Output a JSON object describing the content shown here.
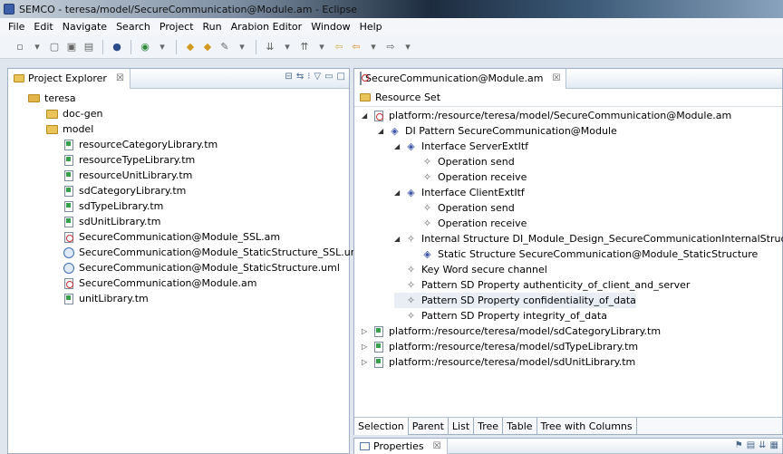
{
  "window": {
    "title": "SEMCO - teresa/model/SecureCommunication@Module.am - Eclipse"
  },
  "menu": [
    "File",
    "Edit",
    "Navigate",
    "Search",
    "Project",
    "Run",
    "Arabion Editor",
    "Window",
    "Help"
  ],
  "project_explorer": {
    "tab_label": "Project Explorer",
    "close": "☒",
    "root": "teresa",
    "folders": [
      "doc-gen",
      "model"
    ],
    "files": [
      {
        "name": "resourceCategoryLibrary.tm",
        "kind": "tm"
      },
      {
        "name": "resourceTypeLibrary.tm",
        "kind": "tm"
      },
      {
        "name": "resourceUnitLibrary.tm",
        "kind": "tm"
      },
      {
        "name": "sdCategoryLibrary.tm",
        "kind": "tm"
      },
      {
        "name": "sdTypeLibrary.tm",
        "kind": "tm"
      },
      {
        "name": "sdUnitLibrary.tm",
        "kind": "tm"
      },
      {
        "name": "SecureCommunication@Module_SSL.am",
        "kind": "am"
      },
      {
        "name": "SecureCommunication@Module_StaticStructure_SSL.uml",
        "kind": "uml"
      },
      {
        "name": "SecureCommunication@Module_StaticStructure.uml",
        "kind": "uml"
      },
      {
        "name": "SecureCommunication@Module.am",
        "kind": "am"
      },
      {
        "name": "unitLibrary.tm",
        "kind": "tm"
      }
    ]
  },
  "editor": {
    "tab_label": "SecureCommunication@Module.am",
    "close": "☒",
    "resource_set_label": "Resource Set",
    "tree": [
      {
        "label": "platform:/resource/teresa/model/SecureCommunication@Module.am",
        "level": 0,
        "arrow": "◢",
        "icon": "am"
      },
      {
        "label": "DI Pattern SecureCommunication@Module",
        "level": 1,
        "arrow": "◢",
        "icon": "diamond"
      },
      {
        "label": "Interface ServerExtItf",
        "level": 2,
        "arrow": "◢",
        "icon": "diamond"
      },
      {
        "label": "Operation send",
        "level": 3,
        "arrow": "",
        "icon": "diamond-g"
      },
      {
        "label": "Operation receive",
        "level": 3,
        "arrow": "",
        "icon": "diamond-g"
      },
      {
        "label": "Interface ClientExtItf",
        "level": 2,
        "arrow": "◢",
        "icon": "diamond"
      },
      {
        "label": "Operation send",
        "level": 3,
        "arrow": "",
        "icon": "diamond-g"
      },
      {
        "label": "Operation receive",
        "level": 3,
        "arrow": "",
        "icon": "diamond-g"
      },
      {
        "label": "Internal Structure DI_Module_Design_SecureCommunicationInternalStructure",
        "level": 2,
        "arrow": "◢",
        "icon": "diamond-g"
      },
      {
        "label": "Static Structure SecureCommunication@Module_StaticStructure",
        "level": 3,
        "arrow": "",
        "icon": "diamond"
      },
      {
        "label": "Key Word secure channel",
        "level": 2,
        "arrow": "",
        "icon": "diamond-g"
      },
      {
        "label": "Pattern SD Property authenticity_of_client_and_server",
        "level": 2,
        "arrow": "",
        "icon": "diamond-g"
      },
      {
        "label": "Pattern SD Property confidentiality_of_data",
        "level": 2,
        "arrow": "",
        "icon": "diamond-g",
        "selected": true
      },
      {
        "label": "Pattern SD Property integrity_of_data",
        "level": 2,
        "arrow": "",
        "icon": "diamond-g"
      },
      {
        "label": "platform:/resource/teresa/model/sdCategoryLibrary.tm",
        "level": 0,
        "arrow": "▷",
        "icon": "tm"
      },
      {
        "label": "platform:/resource/teresa/model/sdTypeLibrary.tm",
        "level": 0,
        "arrow": "▷",
        "icon": "tm"
      },
      {
        "label": "platform:/resource/teresa/model/sdUnitLibrary.tm",
        "level": 0,
        "arrow": "▷",
        "icon": "tm"
      }
    ],
    "bottom_tabs": [
      "Selection",
      "Parent",
      "List",
      "Tree",
      "Table",
      "Tree with Columns"
    ]
  },
  "properties": {
    "tab_label": "Properties",
    "close": "☒"
  }
}
